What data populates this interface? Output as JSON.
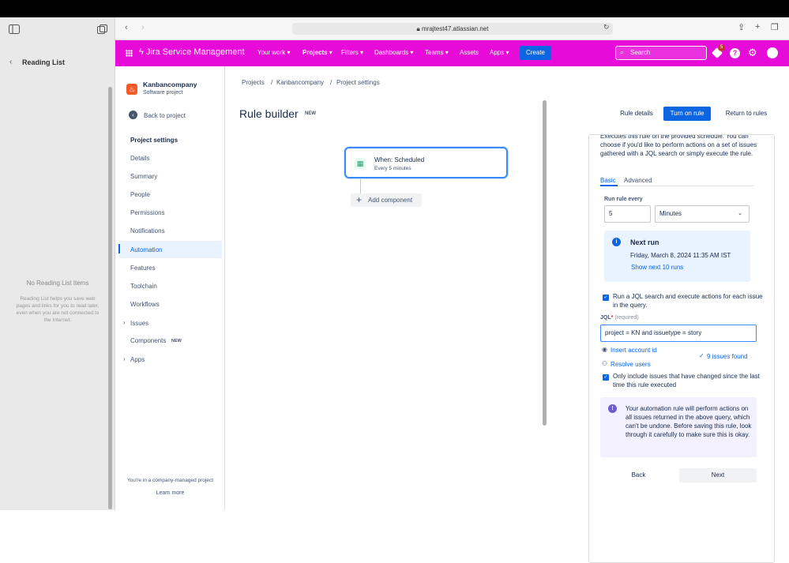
{
  "safari": {
    "reading_list_title": "Reading List",
    "empty_title": "No Reading List Items",
    "empty_desc": "Reading List helps you save web pages and links for you to read later, even when you are not connected to the Internet.",
    "url": "mrajtest47.atlassian.net"
  },
  "nav": {
    "brand": "Jira Service Management",
    "items": [
      "Your work",
      "Projects",
      "Filters",
      "Dashboards",
      "Teams",
      "Assets",
      "Apps"
    ],
    "create": "Create",
    "search_placeholder": "Search",
    "notif_count": "5"
  },
  "sidebar": {
    "project_name": "Kanbancompany",
    "project_type": "Software project",
    "back": "Back to project",
    "section": "Project settings",
    "items": [
      "Details",
      "Summary",
      "People",
      "Permissions",
      "Notifications",
      "Automation",
      "Features",
      "Toolchain",
      "Workflows",
      "Issues",
      "Components",
      "Apps"
    ],
    "components_badge": "NEW",
    "footer": "You're in a company-managed project",
    "learn_more": "Learn more"
  },
  "main": {
    "breadcrumbs": [
      "Projects",
      "Kanbancompany",
      "Project settings"
    ],
    "title": "Rule builder",
    "title_badge": "NEW",
    "rule_details": "Rule details",
    "turn_on": "Turn on rule",
    "return": "Return to rules",
    "trigger_title": "When: Scheduled",
    "trigger_sub": "Every 5 minutes",
    "add_component": "Add component"
  },
  "panel": {
    "intro": "Executes this rule on the provided schedule. You can choose if you'd like to perform actions on a set of issues gathered with a JQL search or simply execute the rule.",
    "tab_basic": "Basic",
    "tab_advanced": "Advanced",
    "run_every_label": "Run rule every",
    "run_every_value": "5",
    "unit": "Minutes",
    "next_run_title": "Next run",
    "next_run_date": "Friday, March 8, 2024 11:35 AM IST",
    "show_next": "Show next 10 runs",
    "jql_checkbox": "Run a JQL search and execute actions for each issue in the query.",
    "jql_label": "JQL",
    "jql_required": "(required)",
    "jql_value": "project = KN and issuetype = story",
    "insert_account": "Insert account id",
    "resolve_users": "Resolve users",
    "issues_found": "9 issues found",
    "only_changed": "Only include issues that have changed since the last time this rule executed",
    "warning": "Your automation rule will perform actions on all issues returned in the above query, which can't be undone. Before saving this rule, look through it carefully to make sure this is okay.",
    "back": "Back",
    "next": "Next"
  },
  "colors": {
    "nav_bg": "#e60bd9",
    "primary": "#0c66e4",
    "info_bg": "#e9f2ff",
    "warning_bg": "#f3f0ff"
  }
}
